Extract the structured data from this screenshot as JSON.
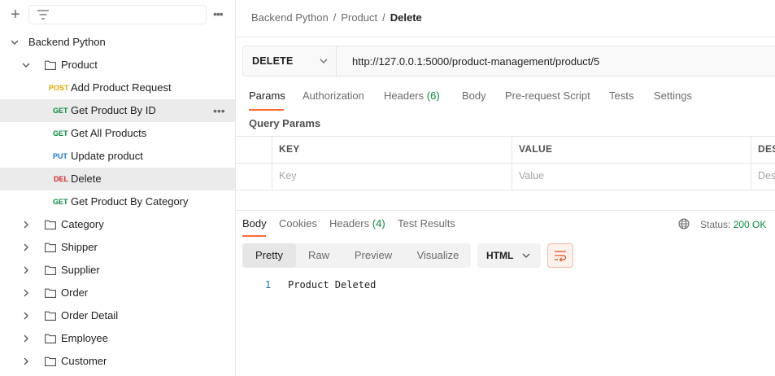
{
  "sidebar": {
    "collection": "Backend Python",
    "folder_open": "Product",
    "requests": [
      {
        "method": "POST",
        "label": "Add Product Request",
        "color": "#e0a500"
      },
      {
        "method": "GET",
        "label": "Get Product By ID",
        "color": "#0a8a3e"
      },
      {
        "method": "GET",
        "label": "Get All Products",
        "color": "#0a8a3e"
      },
      {
        "method": "PUT",
        "label": "Update product",
        "color": "#1f74d4"
      },
      {
        "method": "DEL",
        "label": "Delete",
        "color": "#d12c2c"
      },
      {
        "method": "GET",
        "label": "Get Product By Category",
        "color": "#0a8a3e"
      }
    ],
    "folders": [
      "Category",
      "Shipper",
      "Supplier",
      "Order",
      "Order Detail",
      "Employee",
      "Customer"
    ],
    "more_glyph": "•••"
  },
  "breadcrumb": {
    "items": [
      "Backend Python",
      "Product"
    ],
    "current": "Delete",
    "separator": "/"
  },
  "request": {
    "method": "DELETE",
    "url": "http://127.0.0.1:5000/product-management/product/5"
  },
  "request_tabs": [
    {
      "label": "Params"
    },
    {
      "label": "Authorization"
    },
    {
      "label": "Headers",
      "count": "(6)"
    },
    {
      "label": "Body"
    },
    {
      "label": "Pre-request Script"
    },
    {
      "label": "Tests"
    },
    {
      "label": "Settings"
    }
  ],
  "query_params": {
    "title": "Query Params",
    "headers": [
      "KEY",
      "VALUE",
      "DES"
    ],
    "placeholders": [
      "Key",
      "Value",
      "Des"
    ]
  },
  "response_tabs": [
    {
      "label": "Body"
    },
    {
      "label": "Cookies"
    },
    {
      "label": "Headers",
      "count": "(4)"
    },
    {
      "label": "Test Results"
    }
  ],
  "status": {
    "label": "Status:",
    "value": "200 OK"
  },
  "view_modes": [
    "Pretty",
    "Raw",
    "Preview",
    "Visualize"
  ],
  "format": "HTML",
  "response_body": {
    "line_no": "1",
    "text": "Product Deleted"
  },
  "colors": {
    "accent": "#ff6c37",
    "success": "#0a8a3e"
  }
}
